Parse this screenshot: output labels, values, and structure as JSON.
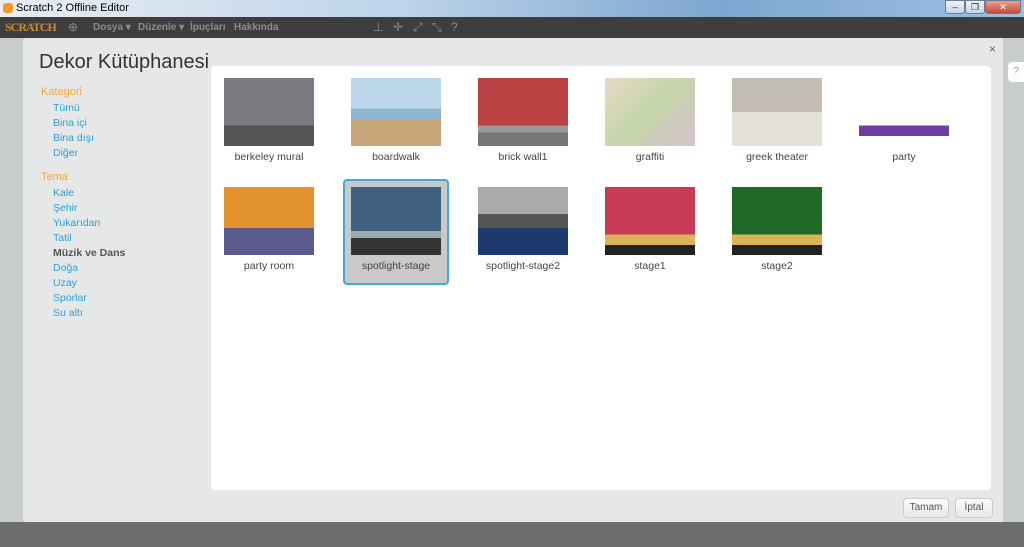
{
  "window": {
    "title": "Scratch 2 Offline Editor",
    "controls": [
      "–",
      "❐",
      "✕"
    ]
  },
  "menubar": {
    "logo": "SCRATCH",
    "items": [
      "Dosya ▾",
      "Düzenle ▾",
      "İpuçları",
      "Hakkında"
    ],
    "icons": [
      "stamp-icon",
      "grow-icon",
      "shrink-icon",
      "fullscreen-icon",
      "help-icon"
    ]
  },
  "modal": {
    "title": "Dekor Kütüphanesi",
    "close": "×",
    "categories_heading": "Kategori",
    "categories": [
      "Tümü",
      "Bina içi",
      "Bina dışı",
      "Diğer"
    ],
    "themes_heading": "Tema",
    "themes": [
      "Kale",
      "Şehir",
      "Yukarıdan",
      "Tatil",
      "Müzik ve Dans",
      "Doğa",
      "Uzay",
      "Sporlar",
      "Su altı"
    ],
    "selected_theme": "Müzik ve Dans",
    "backdrops": [
      {
        "name": "berkeley mural"
      },
      {
        "name": "boardwalk"
      },
      {
        "name": "brick wall1"
      },
      {
        "name": "graffiti"
      },
      {
        "name": "greek theater"
      },
      {
        "name": "party"
      },
      {
        "name": "party room"
      },
      {
        "name": "spotlight-stage",
        "selected": true
      },
      {
        "name": "spotlight-stage2"
      },
      {
        "name": "stage1"
      },
      {
        "name": "stage2"
      }
    ],
    "ok": "Tamam",
    "cancel": "İptal"
  },
  "colors": {
    "accent": "#3fa9e0",
    "category_heading": "#f8a53a",
    "link": "#2ba0d8"
  }
}
